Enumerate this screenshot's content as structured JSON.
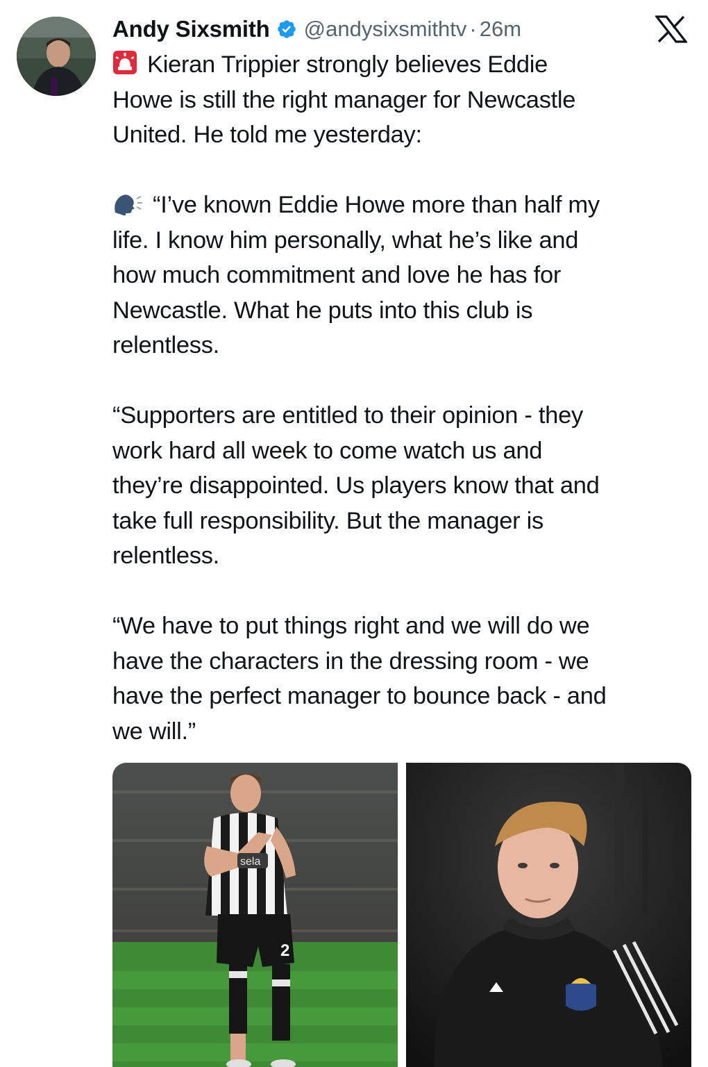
{
  "tweet": {
    "author_name": "Andy Sixsmith",
    "handle": "@andysixsmithtv",
    "separator": "·",
    "time": "26m",
    "paragraphs": [
      {
        "emoji": "rotating-light-emoji",
        "lines": [
          "Kieran Trippier strongly believes Eddie",
          "Howe is still the right manager for Newcastle",
          "United. He told me yesterday:"
        ]
      },
      {
        "emoji": "speaking-head-emoji",
        "lines": [
          "“I’ve known Eddie Howe more than half my",
          "life. I know him personally, what he’s like and",
          "how much commitment and love he has for",
          "Newcastle. What he puts into this club is",
          "relentless."
        ]
      },
      {
        "lines": [
          "“Supporters are entitled to their opinion - they",
          "work hard all week to come watch us and",
          "they’re disappointed. Us players know that and",
          "take full responsibility. But the manager is",
          "relentless."
        ]
      },
      {
        "lines": [
          "“We have to put things right and we will do we",
          "have the characters in the dressing room - we",
          "have the perfect manager to bounce back - and",
          "we will.”"
        ]
      }
    ]
  },
  "media": {
    "left_photo": {
      "icon": "player-photo",
      "shirt_text": "sela",
      "shirt_number": "2"
    },
    "right_photo": {
      "icon": "manager-photo"
    }
  },
  "colors": {
    "text": "#0f1419",
    "secondary": "#536471",
    "verified": "#1d9bf0",
    "pitch": "#3f8a35"
  },
  "icons": {
    "verified": "verified-badge-icon",
    "platform": "x-logo-icon"
  }
}
